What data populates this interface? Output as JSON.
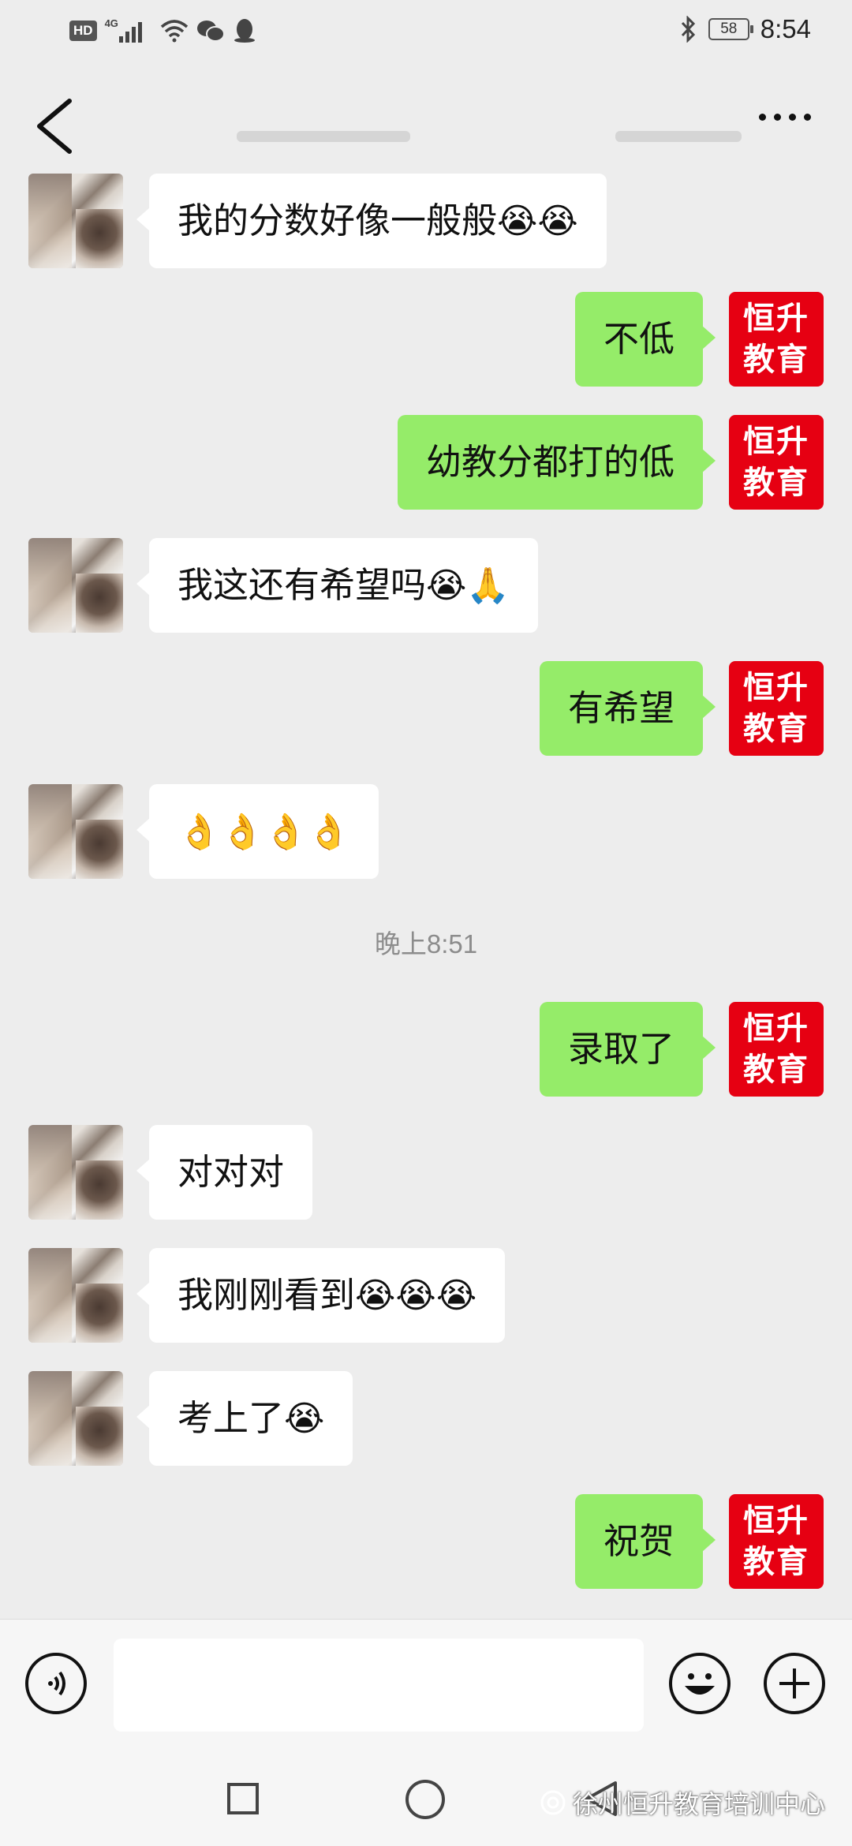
{
  "status_bar": {
    "network_badge": "HD",
    "network_type": "4G",
    "battery_level": "58",
    "time": "8:54"
  },
  "header": {
    "back_icon": "chevron-left-icon",
    "more_icon": "more-dots-icon"
  },
  "timestamp": "晚上8:51",
  "brand_avatar": {
    "line1": "恒升",
    "line2": "教育",
    "color": "#e60012"
  },
  "colors": {
    "sent_bubble": "#95ec69",
    "received_bubble": "#ffffff",
    "background": "#ededed"
  },
  "messages": [
    {
      "side": "left",
      "text": "我的分数好像一般般",
      "emoji": "😭😭"
    },
    {
      "side": "right",
      "text": "不低",
      "emoji": ""
    },
    {
      "side": "right",
      "text": "幼教分都打的低",
      "emoji": ""
    },
    {
      "side": "left",
      "text": "我这还有希望吗",
      "emoji": "😭🙏"
    },
    {
      "side": "right",
      "text": "有希望",
      "emoji": ""
    },
    {
      "side": "left",
      "text": "",
      "emoji": "👌👌👌👌"
    },
    {
      "side": "right",
      "text": "录取了",
      "emoji": ""
    },
    {
      "side": "left",
      "text": "对对对",
      "emoji": ""
    },
    {
      "side": "left",
      "text": "我刚刚看到",
      "emoji": "😭😭😭"
    },
    {
      "side": "left",
      "text": "考上了",
      "emoji": "😭"
    },
    {
      "side": "right",
      "text": "祝贺",
      "emoji": ""
    }
  ],
  "input_bar": {
    "voice_icon": "voice-icon",
    "emoji_icon": "smiley-icon",
    "plus_icon": "plus-icon"
  },
  "watermark": "徐州恒升教育培训中心"
}
